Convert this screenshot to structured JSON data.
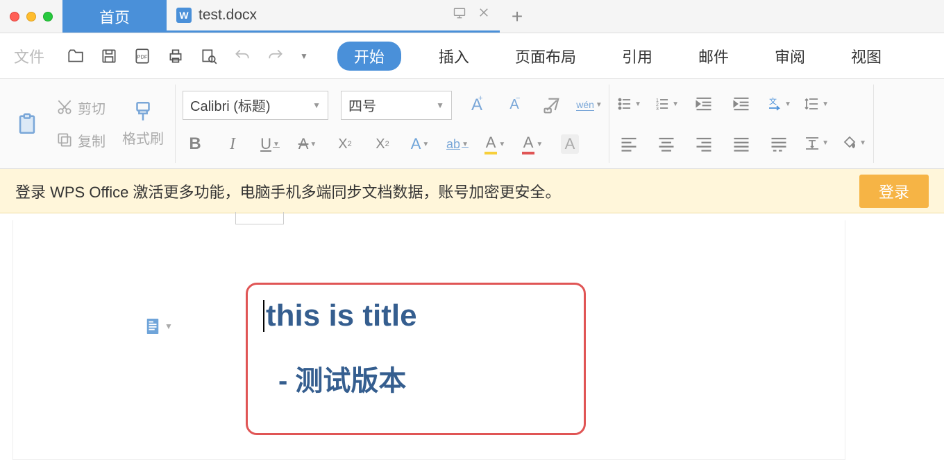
{
  "tabs": {
    "home": "首页",
    "doc_name": "test.docx",
    "doc_icon_letter": "W"
  },
  "menu": {
    "file": "文件",
    "ribbon_tabs": [
      "开始",
      "插入",
      "页面布局",
      "引用",
      "邮件",
      "审阅",
      "视图"
    ]
  },
  "ribbon": {
    "cut": "剪切",
    "copy": "复制",
    "format_painter": "格式刷",
    "font_name": "Calibri (标题)",
    "font_size": "四号",
    "wen_label": "wén"
  },
  "banner": {
    "text": "登录 WPS Office 激活更多功能，电脑手机多端同步文档数据，账号加密更安全。",
    "button": "登录"
  },
  "document": {
    "title_text": "this is title",
    "subtitle_text": "- 测试版本"
  }
}
